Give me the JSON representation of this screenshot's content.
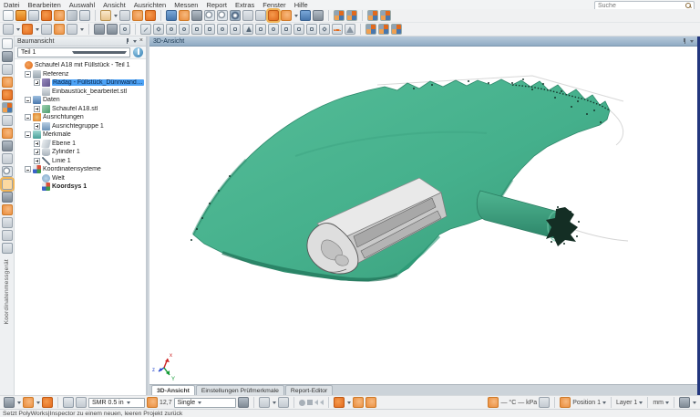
{
  "app": {
    "search_placeholder": "Suche"
  },
  "menubar": {
    "items": [
      "Datei",
      "Bearbeiten",
      "Auswahl",
      "Ansicht",
      "Ausrichten",
      "Messen",
      "Report",
      "Extras",
      "Fenster",
      "Hilfe"
    ]
  },
  "tree_panel": {
    "title": "Baumansicht",
    "close_glyph": "×",
    "part_selector": {
      "value": "Teil 1"
    },
    "nodes": [
      {
        "label": "Schaufel A18 mit Füllstück - Teil 1"
      },
      {
        "label": "Referenz"
      },
      {
        "label": "Radag - Füllstück_Dünnwandteil.igs .stp"
      },
      {
        "label": "Einbaustück_bearbeitet.stl"
      },
      {
        "label": "Daten"
      },
      {
        "label": "Schaufel A18.stl"
      },
      {
        "label": "Ausrichtungen"
      },
      {
        "label": "Ausrichtegruppe 1"
      },
      {
        "label": "Merkmale"
      },
      {
        "label": "Ebene 1"
      },
      {
        "label": "Zylinder 1"
      },
      {
        "label": "Linie 1"
      },
      {
        "label": "Koordinatensysteme"
      },
      {
        "label": "Welt"
      },
      {
        "label": "Koordsys 1"
      }
    ]
  },
  "viewport": {
    "title": "3D-Ansicht",
    "axis_labels": {
      "x": "x",
      "y": "Y",
      "z": "z"
    },
    "tabs": [
      {
        "label": "3D-Ansicht"
      },
      {
        "label": "Einstellungen Prüfmerkmale"
      },
      {
        "label": "Report-Editor"
      }
    ]
  },
  "left_rail": {
    "tab_label": "Koordinatenmessgerät"
  },
  "bottom_toolbar": {
    "smr_value": "SMR 0.5 in",
    "probe_value": "12,7",
    "mode_value": "Single",
    "environment": "— °C  — kPa",
    "position_value": "Position 1",
    "layer_value": "Layer 1",
    "units_value": "mm"
  },
  "statusbar": {
    "message": "Setzt PolyWorks|Inspector zu einem neuen, leeren Projekt zurück"
  },
  "model": {
    "colors": {
      "scan_green": "#45b08c",
      "scan_dark": "#1d6f55",
      "cad_gray": "#cdcdcd",
      "selection_blue": "#4da2f5",
      "titlebar_blue": "#90abc4",
      "accent_orange": "#e2691c"
    }
  }
}
